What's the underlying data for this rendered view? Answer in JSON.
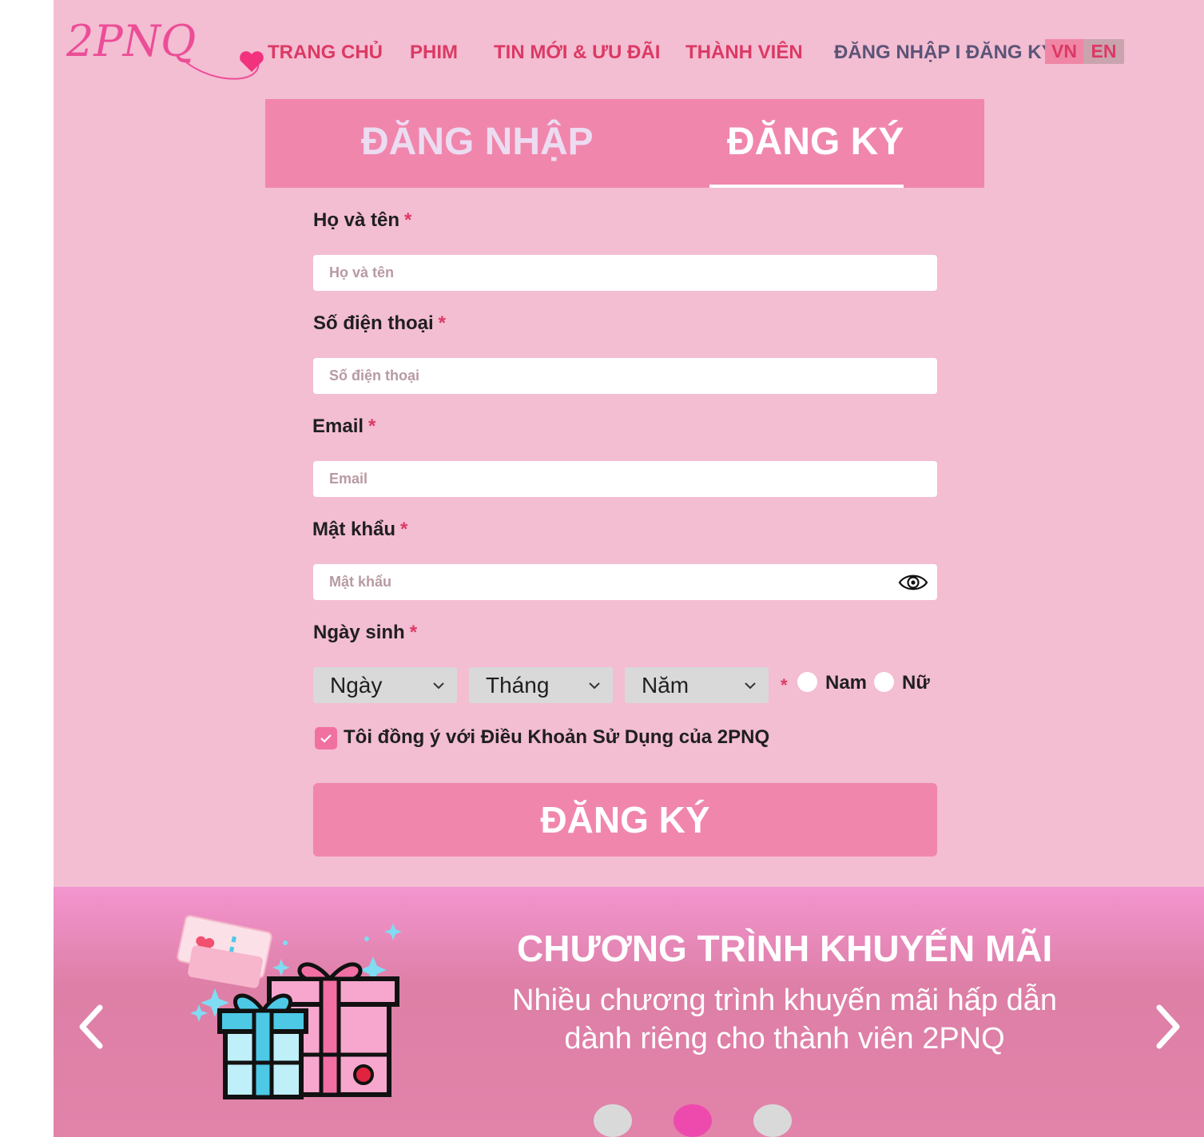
{
  "header": {
    "logo_text": "2PNQ",
    "nav": [
      {
        "label": "TRANG CHỦ"
      },
      {
        "label": "PHIM"
      },
      {
        "label": "TIN MỚI & ƯU ĐÃI"
      },
      {
        "label": "THÀNH VIÊN"
      }
    ],
    "auth_link": "ĐĂNG NHẬP I ĐĂNG KÝ",
    "lang": {
      "vn": "VN",
      "en": "EN",
      "active": "VN"
    }
  },
  "tabs": [
    {
      "label": "ĐĂNG NHẬP",
      "active": false
    },
    {
      "label": "ĐĂNG KÝ",
      "active": true
    }
  ],
  "form": {
    "required_mark": "*",
    "full_name": {
      "label": "Họ và tên",
      "placeholder": "Họ và tên",
      "value": ""
    },
    "phone": {
      "label": "Số điện thoại",
      "placeholder": "Số điện thoại",
      "value": ""
    },
    "email": {
      "label": "Email",
      "placeholder": "Email",
      "value": ""
    },
    "password": {
      "label": "Mật khẩu",
      "placeholder": "Mật khẩu",
      "value": "",
      "icon": "eye-icon"
    },
    "birthday": {
      "label": "Ngày sinh",
      "day": "Ngày",
      "month": "Tháng",
      "year": "Năm"
    },
    "gender": {
      "male": "Nam",
      "female": "Nữ",
      "selected": null
    },
    "terms": {
      "label": "Tôi đồng ý với Điều Khoản Sử Dụng của 2PNQ",
      "checked": true
    },
    "submit_label": "ĐĂNG KÝ"
  },
  "promo": {
    "title": "CHƯƠNG TRÌNH KHUYẾN MÃI",
    "description": "Nhiều chương trình khuyến mãi hấp dẫn dành riêng cho thành viên 2PNQ",
    "slides": 3,
    "active_slide": 2
  },
  "colors": {
    "page_bg": "#f3bdd2",
    "accent": "#f186ad",
    "nav_text": "#dc3964",
    "auth_text": "#5b5478",
    "active_dot": "#ee4aae",
    "inactive_dot": "#d9d9d9"
  }
}
